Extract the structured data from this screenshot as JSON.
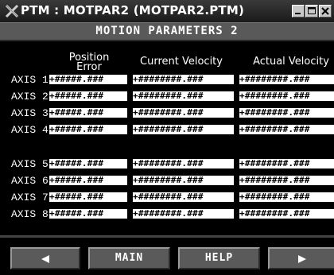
{
  "window": {
    "title": "PTM : MOTPAR2 (MOTPAR2.PTM)"
  },
  "screen": {
    "header": "MOTION PARAMETERS 2"
  },
  "columns": {
    "position_error": "Position\nError",
    "current_velocity": "Current Velocity",
    "actual_velocity": "Actual Velocity"
  },
  "axes": [
    {
      "label": "AXIS 1",
      "position_error": "+#####.###",
      "current_velocity": "+########.###",
      "actual_velocity": "+########.###"
    },
    {
      "label": "AXIS 2",
      "position_error": "+#####.###",
      "current_velocity": "+########.###",
      "actual_velocity": "+########.###"
    },
    {
      "label": "AXIS 3",
      "position_error": "+#####.###",
      "current_velocity": "+########.###",
      "actual_velocity": "+########.###"
    },
    {
      "label": "AXIS 4",
      "position_error": "+#####.###",
      "current_velocity": "+########.###",
      "actual_velocity": "+########.###"
    },
    {
      "label": "AXIS 5",
      "position_error": "+#####.###",
      "current_velocity": "+########.###",
      "actual_velocity": "+########.###"
    },
    {
      "label": "AXIS 6",
      "position_error": "+#####.###",
      "current_velocity": "+########.###",
      "actual_velocity": "+########.###"
    },
    {
      "label": "AXIS 7",
      "position_error": "+#####.###",
      "current_velocity": "+########.###",
      "actual_velocity": "+########.###"
    },
    {
      "label": "AXIS 8",
      "position_error": "+#####.###",
      "current_velocity": "+########.###",
      "actual_velocity": "+########.###"
    }
  ],
  "footer": {
    "prev_icon": "left-arrow-icon",
    "main_label": "MAIN",
    "help_label": "HELP",
    "next_icon": "right-arrow-icon"
  }
}
